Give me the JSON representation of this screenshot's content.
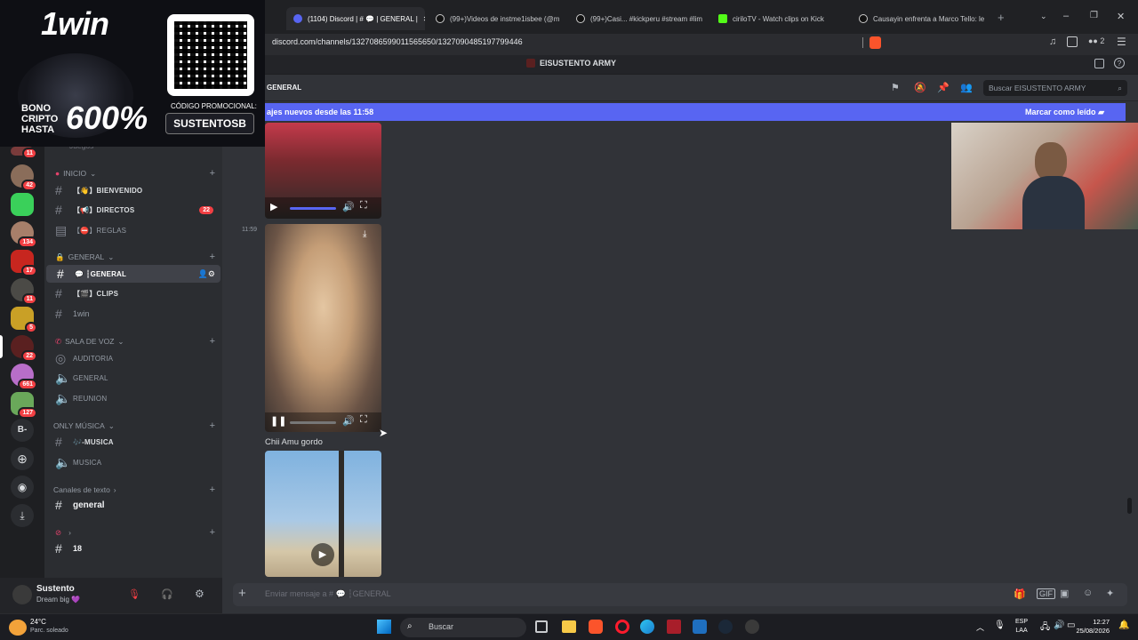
{
  "browser": {
    "tabs": [
      {
        "label": "(1104) Discord | # 💬 | GENERAL |",
        "active": true
      },
      {
        "label": "(99+)Videos de instme1isbee (@m"
      },
      {
        "label": "(99+)Casi... #kickperu #stream #lim"
      },
      {
        "label": "ciriloTV - Watch clips on Kick"
      },
      {
        "label": "Causayin enfrenta a Marco Tello: le"
      }
    ],
    "url": "discord.com/channels/1327086599011565650/1327090485197799446",
    "ext_count": "2"
  },
  "ad": {
    "brand": "1win",
    "bonus_line1": "BONO",
    "bonus_line2": "CRIPTO",
    "bonus_line3": "HASTA",
    "percent": "600%",
    "promo_label": "CÓDIGO PROMOCIONAL:",
    "promo_code": "SUSTENTOSB"
  },
  "server": {
    "name": "EISUSTENTO ARMY",
    "badges": [
      "11",
      "42",
      "134",
      "17",
      "11",
      "5",
      "22",
      "661",
      "127"
    ],
    "letter_server": "B-"
  },
  "channels": {
    "top_partial": "Juegos",
    "categories": [
      {
        "name": "INICIO",
        "items": [
          {
            "label": "【👋】BIENVENIDO"
          },
          {
            "label": "【📢】DIRECTOS",
            "badge": "22"
          },
          {
            "label": "【⛔】REGLAS"
          }
        ]
      },
      {
        "name": "GENERAL",
        "items": [
          {
            "label": "💬 ┆GENERAL"
          },
          {
            "label": "【🎬】CLIPS"
          },
          {
            "label": "1win"
          }
        ]
      },
      {
        "name": "SALA DE VOZ",
        "items": [
          {
            "label": "AUDITORIA"
          },
          {
            "label": "GENERAL"
          },
          {
            "label": "REUNION"
          }
        ]
      },
      {
        "name": "ONLY MÚSICA",
        "items": [
          {
            "label": "🎶-MUSICA"
          },
          {
            "label": "MUSICA"
          }
        ]
      },
      {
        "name": "Canales de texto",
        "items": [
          {
            "label": "general"
          }
        ]
      },
      {
        "name": "",
        "items": [
          {
            "label": "18"
          }
        ]
      }
    ]
  },
  "header": {
    "channel": "GENERAL",
    "search_placeholder": "Buscar EISUSTENTO ARMY"
  },
  "banner": {
    "text": "ajes nuevos desde las 11:58",
    "action": "Marcar como leído"
  },
  "messages": {
    "timestamp": "11:59",
    "caption": "Chii Amu gordo"
  },
  "composer": {
    "placeholder": "Enviar mensaje a # 💬 ┆GENERAL"
  },
  "user": {
    "name": "Sustento",
    "status": "Dream big 💜"
  },
  "taskbar": {
    "temp": "24°C",
    "weather": "Parc. soleado",
    "search": "Buscar",
    "lang1": "ESP",
    "lang2": "LAA",
    "time": "12:27",
    "date": "25/08/2026"
  }
}
